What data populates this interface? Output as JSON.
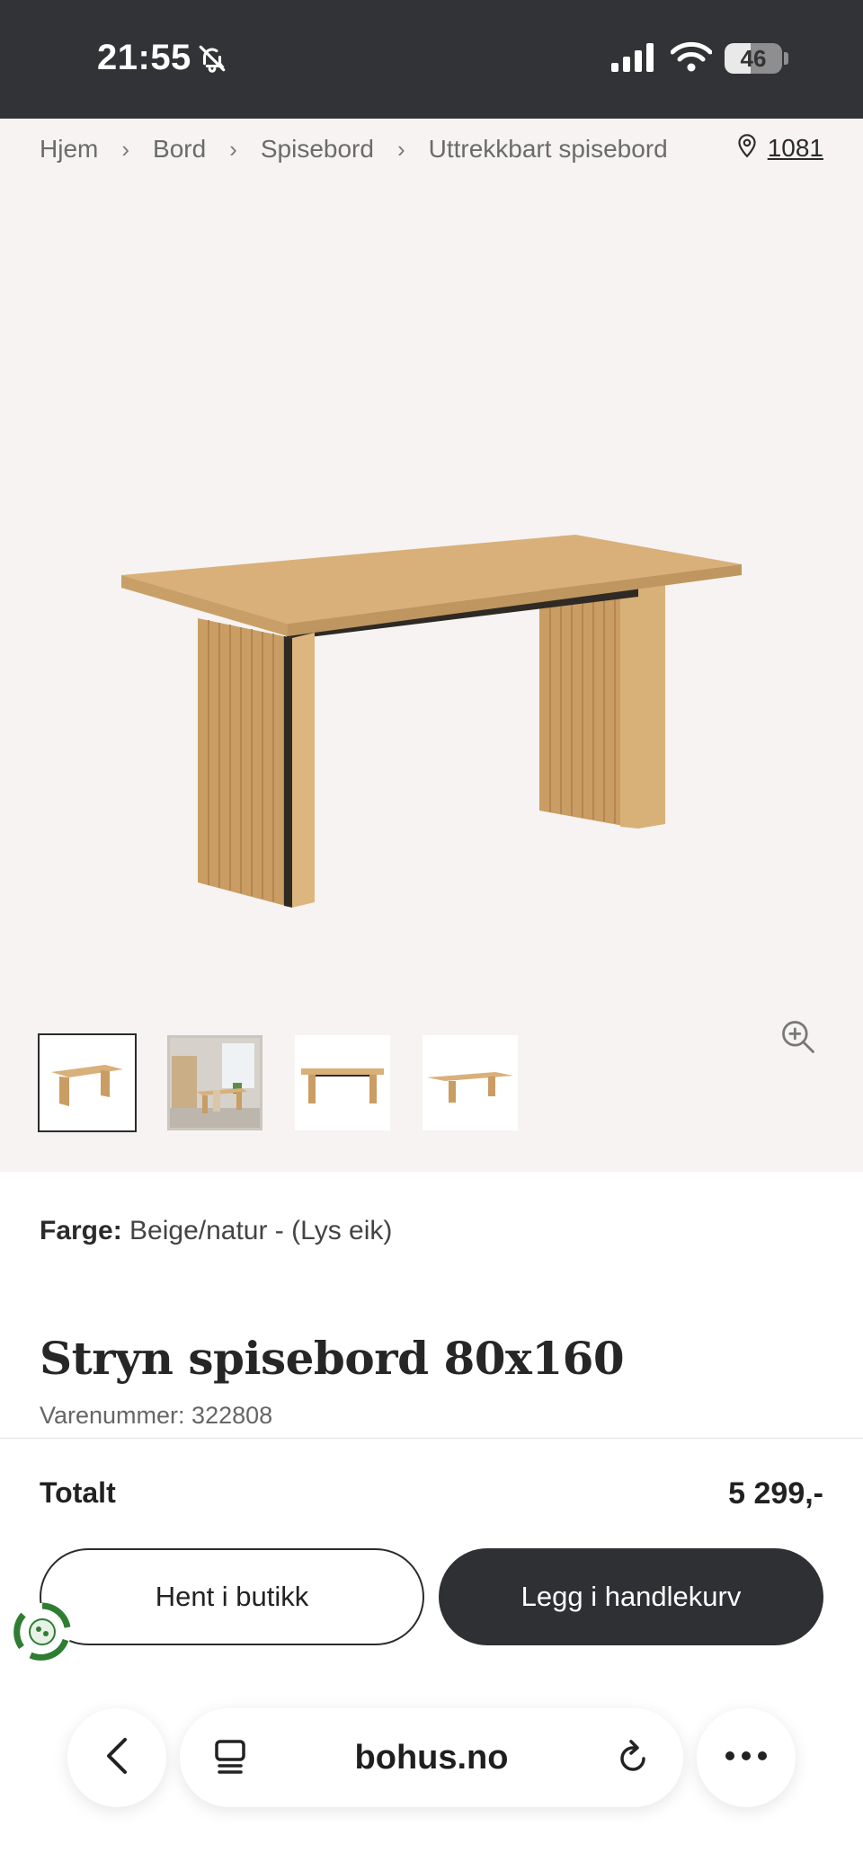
{
  "status_bar": {
    "time": "21:55",
    "battery_level": "46",
    "battery_fraction": 0.46,
    "icons": [
      "bell-off-icon",
      "signal-icon",
      "wifi-icon",
      "battery-icon"
    ]
  },
  "breadcrumb": {
    "items": [
      "Hjem",
      "Bord",
      "Spisebord",
      "Uttrekkbart spisebord"
    ],
    "separator": "›"
  },
  "location": {
    "icon": "map-pin-icon",
    "code": "1081"
  },
  "gallery": {
    "zoom_icon": "zoom-in-icon",
    "thumbnails": [
      {
        "name": "thumb-table-angle",
        "active": true
      },
      {
        "name": "thumb-room-scene",
        "active": false
      },
      {
        "name": "thumb-table-front",
        "active": false
      },
      {
        "name": "thumb-table-side",
        "active": false
      }
    ]
  },
  "product": {
    "color_label": "Farge:",
    "color_value": "Beige/natur - (Lys eik)",
    "title": "Stryn spisebord 80x160",
    "sku_text": "Varenummer: 322808"
  },
  "purchase": {
    "total_label": "Totalt",
    "total_price": "5 299,-",
    "pickup_button": "Hent i butikk",
    "cart_button": "Legg i handlekurv"
  },
  "browser": {
    "url": "bohus.no",
    "icons": [
      "back-chevron-icon",
      "reader-icon",
      "reload-icon",
      "more-icon"
    ]
  },
  "colors": {
    "status_bar_bg": "#323336",
    "gallery_bg": "#f6f3f2",
    "primary_button_bg": "#2f3033",
    "wood": "#d9b07a",
    "eco_green": "#2e7d32"
  }
}
